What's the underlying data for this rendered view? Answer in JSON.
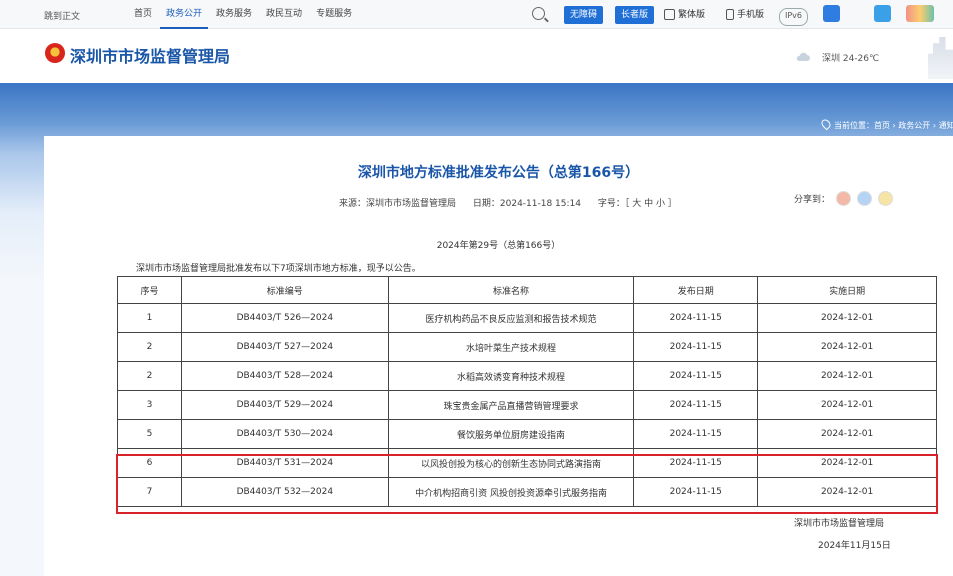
{
  "topbar": {
    "skip": "跳到正文",
    "nav": [
      "首页",
      "政务公开",
      "政务服务",
      "政民互动",
      "专题服务"
    ],
    "active_index": 1,
    "accessibility": "无障碍",
    "elder": "长者版",
    "traditional": "繁体版",
    "mobile": "手机版",
    "ipv6": "IPv6"
  },
  "header": {
    "site_name": "深圳市市场监督管理局",
    "weather": "深圳 24-26℃"
  },
  "breadcrumb": "当前位置：首页 › 政务公开 › 通知",
  "article": {
    "title": "深圳市地方标准批准发布公告（总第166号）",
    "source": "来源：深圳市市场监督管理局",
    "date": "日期：2024-11-18 15:14",
    "font_size": "字号：［ 大  中  小 ］",
    "share_label": "分享到：",
    "doc_no": "2024年第29号（总第166号）",
    "intro": "深圳市市场监督管理局批准发布以下7项深圳市地方标准，现予以公告。",
    "issuer": "深圳市市场监督管理局",
    "issue_date": "2024年11月15日"
  },
  "table": {
    "headers": [
      "序号",
      "标准编号",
      "标准名称",
      "发布日期",
      "实施日期"
    ],
    "rows": [
      [
        "1",
        "DB4403/T 526—2024",
        "医疗机构药品不良反应监测和报告技术规范",
        "2024-11-15",
        "2024-12-01"
      ],
      [
        "2",
        "DB4403/T 527—2024",
        "水培叶菜生产技术规程",
        "2024-11-15",
        "2024-12-01"
      ],
      [
        "2",
        "DB4403/T 528—2024",
        "水稻高效诱变育种技术规程",
        "2024-11-15",
        "2024-12-01"
      ],
      [
        "3",
        "DB4403/T 529—2024",
        "珠宝贵金属产品直播营销管理要求",
        "2024-11-15",
        "2024-12-01"
      ],
      [
        "5",
        "DB4403/T 530—2024",
        "餐饮服务单位厨房建设指南",
        "2024-11-15",
        "2024-12-01"
      ],
      [
        "6",
        "DB4403/T 531—2024",
        "以风投创投为核心的创新生态协同式路演指南",
        "2024-11-15",
        "2024-12-01"
      ],
      [
        "7",
        "DB4403/T 532—2024",
        "中介机构招商引资  风投创投资源牵引式服务指南",
        "2024-11-15",
        "2024-12-01"
      ]
    ]
  },
  "colors": {
    "brand_blue": "#1a56a8",
    "highlight_red": "#d8232a"
  }
}
